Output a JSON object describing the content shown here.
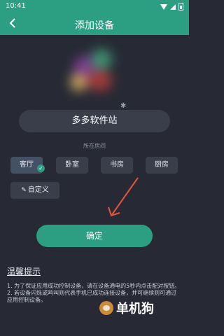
{
  "status_bar": {
    "time": "10:41"
  },
  "app_bar": {
    "back_icon": "back-chevron-icon",
    "title": "添加设备"
  },
  "device": {
    "name": "多多软件站",
    "icon": "device-icon"
  },
  "room": {
    "label": "所在房间",
    "options": [
      {
        "label": "客厅",
        "selected": true
      },
      {
        "label": "卧室",
        "selected": false
      },
      {
        "label": "书房",
        "selected": false
      },
      {
        "label": "厨房",
        "selected": false
      }
    ],
    "custom_label": "自定义"
  },
  "confirm_label": "确定",
  "tips": {
    "title": "温馨提示",
    "line1": "1. 为了保证应用成功控制设备，请在设备通电的5秒内点击配对按钮。",
    "line2": "2. 若设备闪烁或鸣叫则代表手机已成功连接设备，并可继续则可通过应用控制设备。"
  },
  "watermark": {
    "text": "单机狗"
  },
  "colors": {
    "accent": "#2c9f82",
    "background": "#272a35",
    "surface": "#3a3e4b"
  }
}
